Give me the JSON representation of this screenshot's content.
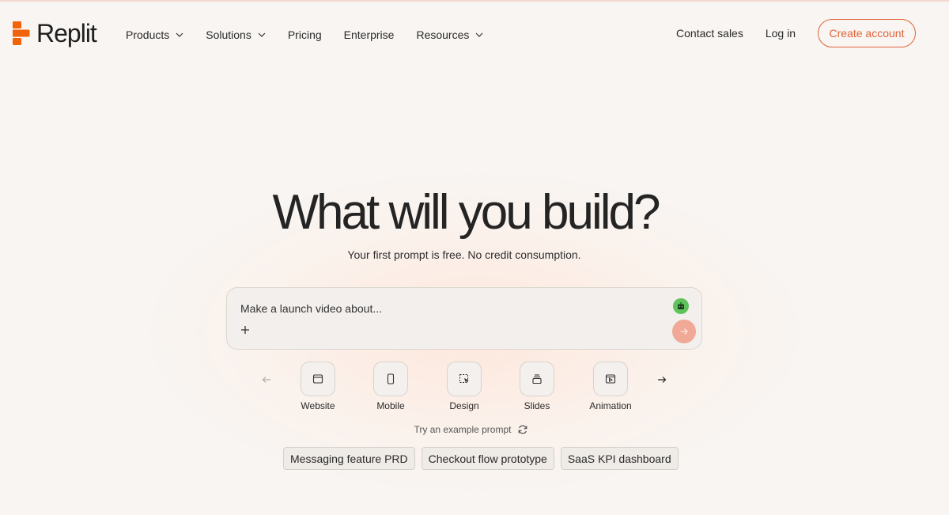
{
  "brand": {
    "name": "Replit",
    "accent_color": "#e0643a"
  },
  "nav": {
    "items": [
      {
        "label": "Products",
        "dropdown": true
      },
      {
        "label": "Solutions",
        "dropdown": true
      },
      {
        "label": "Pricing",
        "dropdown": false
      },
      {
        "label": "Enterprise",
        "dropdown": false
      },
      {
        "label": "Resources",
        "dropdown": true
      }
    ],
    "contact_sales": "Contact sales",
    "log_in": "Log in",
    "create_account": "Create account"
  },
  "hero": {
    "title": "What will you build?",
    "subtitle": "Your first prompt is free. No credit consumption."
  },
  "prompt": {
    "placeholder": "Make a launch video about...",
    "agent_icon": "robot-icon",
    "add_icon": "plus-icon",
    "send_icon": "arrow-right-icon"
  },
  "categories": [
    {
      "label": "Website",
      "icon": "browser-window-icon"
    },
    {
      "label": "Mobile",
      "icon": "phone-icon"
    },
    {
      "label": "Design",
      "icon": "design-select-icon"
    },
    {
      "label": "Slides",
      "icon": "slides-icon"
    },
    {
      "label": "Animation",
      "icon": "animation-play-icon"
    }
  ],
  "examples": {
    "label": "Try an example prompt",
    "chips": [
      "Messaging feature PRD",
      "Checkout flow prototype",
      "SaaS KPI dashboard"
    ]
  }
}
